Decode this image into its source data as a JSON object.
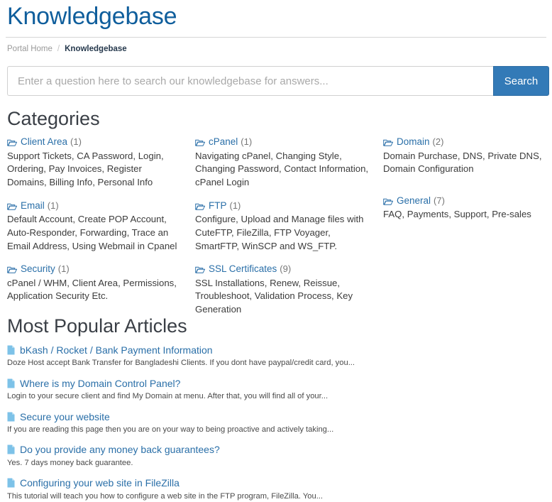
{
  "header": {
    "title": "Knowledgebase"
  },
  "breadcrumb": {
    "home_label": "Portal Home",
    "separator": "/",
    "current_label": "Knowledgebase"
  },
  "search": {
    "value": "",
    "placeholder": "Enter a question here to search our knowledgebase for answers...",
    "button_label": "Search"
  },
  "categories_section": {
    "heading": "Categories",
    "columns": [
      {
        "items": [
          {
            "icon": "folder-icon",
            "name": "Client Area",
            "count": "(1)",
            "description": "Support Tickets, CA Password, Login, Ordering, Pay Invoices, Register Domains, Billing Info, Personal Info"
          },
          {
            "icon": "folder-icon",
            "name": "Email",
            "count": "(1)",
            "description": "Default Account, Create POP Account, Auto-Responder, Forwarding, Trace an Email Address, Using Webmail in Cpanel"
          },
          {
            "icon": "folder-icon",
            "name": "Security",
            "count": "(1)",
            "description": "cPanel / WHM, Client Area, Permissions, Application Security Etc."
          }
        ]
      },
      {
        "items": [
          {
            "icon": "folder-icon",
            "name": "cPanel",
            "count": "(1)",
            "description": "Navigating cPanel, Changing Style, Changing Password, Contact Information, cPanel Login"
          },
          {
            "icon": "folder-icon",
            "name": "FTP",
            "count": "(1)",
            "description": "Configure, Upload and Manage files with CuteFTP, FileZilla, FTP Voyager, SmartFTP, WinSCP and WS_FTP."
          },
          {
            "icon": "folder-icon",
            "name": "SSL Certificates",
            "count": "(9)",
            "description": "SSL Installations, Renew, Reissue, Troubleshoot, Validation Process, Key Generation"
          }
        ]
      },
      {
        "items": [
          {
            "icon": "folder-icon",
            "name": "Domain",
            "count": "(2)",
            "description": "Domain Purchase, DNS, Private DNS, Domain Configuration"
          },
          {
            "icon": "folder-icon",
            "name": "General",
            "count": "(7)",
            "description": "FAQ, Payments, Support, Pre-sales"
          }
        ]
      }
    ]
  },
  "popular_section": {
    "heading": "Most Popular Articles",
    "articles": [
      {
        "icon": "document-icon",
        "title": "bKash / Rocket / Bank Payment Information",
        "description": "Doze Host accept Bank Transfer for Bangladeshi Clients. If you dont have paypal/credit card, you..."
      },
      {
        "icon": "document-icon",
        "title": "Where is my Domain Control Panel?",
        "description": "Login to your secure client and find My Domain at menu. After that, you will find all of your..."
      },
      {
        "icon": "document-icon",
        "title": "Secure your website",
        "description": "If you are reading this page then you are on your way to being proactive and actively taking..."
      },
      {
        "icon": "document-icon",
        "title": "Do you provide any money back guarantees?",
        "description": "Yes. 7 days money back guarantee."
      },
      {
        "icon": "document-icon",
        "title": "Configuring your web site in FileZilla",
        "description": "This tutorial will teach you how to configure a web site in the FTP program, FileZilla. You..."
      }
    ]
  },
  "colors": {
    "title_blue": "#0f5e9c",
    "link_blue": "#2a6fa8",
    "button_blue": "#337ab7",
    "icon_light_blue": "#5bb2e0",
    "heading_gray": "#3a3f46"
  }
}
